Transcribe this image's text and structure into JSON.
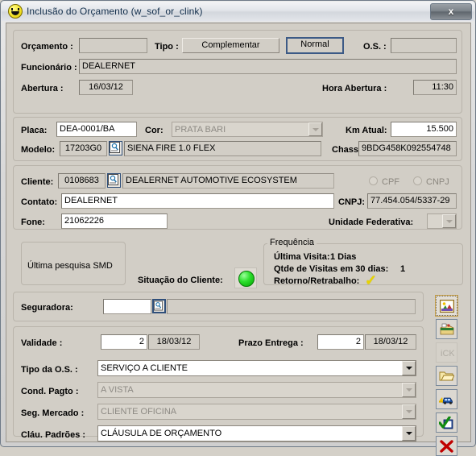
{
  "window": {
    "title": "Inclusão do Orçamento (w_sof_or_clink)",
    "title_icon": "smiley-icon",
    "close_label": "x"
  },
  "budget": {
    "orcamento_label": "Orçamento :",
    "orcamento_value": "",
    "tipo_label": "Tipo :",
    "tipo_complementar": "Complementar",
    "tipo_normal": "Normal",
    "os_label": "O.S. :",
    "os_value": "",
    "funcionario_label": "Funcionário :",
    "funcionario_value": "DEALERNET",
    "abertura_label": "Abertura :",
    "abertura_value": "16/03/12",
    "hora_abertura_label": "Hora Abertura :",
    "hora_abertura_value": "11:30"
  },
  "vehicle": {
    "placa_label": "Placa:",
    "placa_value": "DEA-0001/BA",
    "cor_label": "Cor:",
    "cor_value": "PRATA BARI",
    "km_label": "Km Atual:",
    "km_value": "15.500",
    "modelo_label": "Modelo:",
    "modelo_code": "17203G0",
    "modelo_value": "SIENA FIRE 1.0 FLEX",
    "chassi_label": "Chassi:",
    "chassi_value": "9BDG458K092554748",
    "search_icon": "search-icon"
  },
  "client": {
    "cliente_label": "Cliente:",
    "cliente_code": "0108683",
    "cliente_value": "DEALERNET AUTOMOTIVE ECOSYSTEM",
    "cpf_label": "CPF",
    "cnpj_radio_label": "CNPJ",
    "contato_label": "Contato:",
    "contato_value": "DEALERNET",
    "cnpj_label": "CNPJ:",
    "cnpj_value": "77.454.054/5337-29",
    "fone_label": "Fone:",
    "fone_value": "21062226",
    "uf_label": "Unidade Federativa:",
    "uf_value": "",
    "search_icon": "search-icon"
  },
  "status": {
    "smd_label": "Última pesquisa SMD",
    "situacao_label": "Situação do Cliente:",
    "led_color": "#2ee02e",
    "frequencia_caption": "Frequência",
    "ultima_visita_label": "Última Visita:",
    "ultima_visita_value": "1 Dias",
    "qtde_visitas_label": "Qtde de Visitas em 30 dias:",
    "qtde_visitas_value": "1",
    "retorno_label": "Retorno/Retrabalho:",
    "retorno_icon": "check-icon"
  },
  "insurance": {
    "seguradora_label": "Seguradora:",
    "seguradora_code": "",
    "seguradora_value": "",
    "search_icon": "search-icon"
  },
  "terms": {
    "validade_label": "Validade :",
    "validade_days": "2",
    "validade_date": "18/03/12",
    "prazo_label": "Prazo Entrega :",
    "prazo_days": "2",
    "prazo_date": "18/03/12",
    "tipo_os_label": "Tipo da O.S. :",
    "tipo_os_value": "SERVIÇO A CLIENTE",
    "cond_pagto_label": "Cond. Pagto :",
    "cond_pagto_value": "A VISTA",
    "seg_mercado_label": "Seg. Mercado :",
    "seg_mercado_value": "CLIENTE OFICINA",
    "clau_padroes_label": "Cláu. Padrões :",
    "clau_padroes_value": "CLÁUSULA DE ORÇAMENTO"
  },
  "toolbar": {
    "items": [
      {
        "name": "picture-icon",
        "state": "selected"
      },
      {
        "name": "archive-box-icon",
        "state": "normal"
      },
      {
        "name": "ick-text-icon",
        "state": "disabled",
        "text": "iCK"
      },
      {
        "name": "open-folder-icon",
        "state": "normal"
      },
      {
        "name": "car-icon",
        "state": "normal"
      },
      {
        "name": "green-check-icon",
        "state": "normal"
      },
      {
        "name": "red-x-icon",
        "state": "normal"
      }
    ]
  }
}
